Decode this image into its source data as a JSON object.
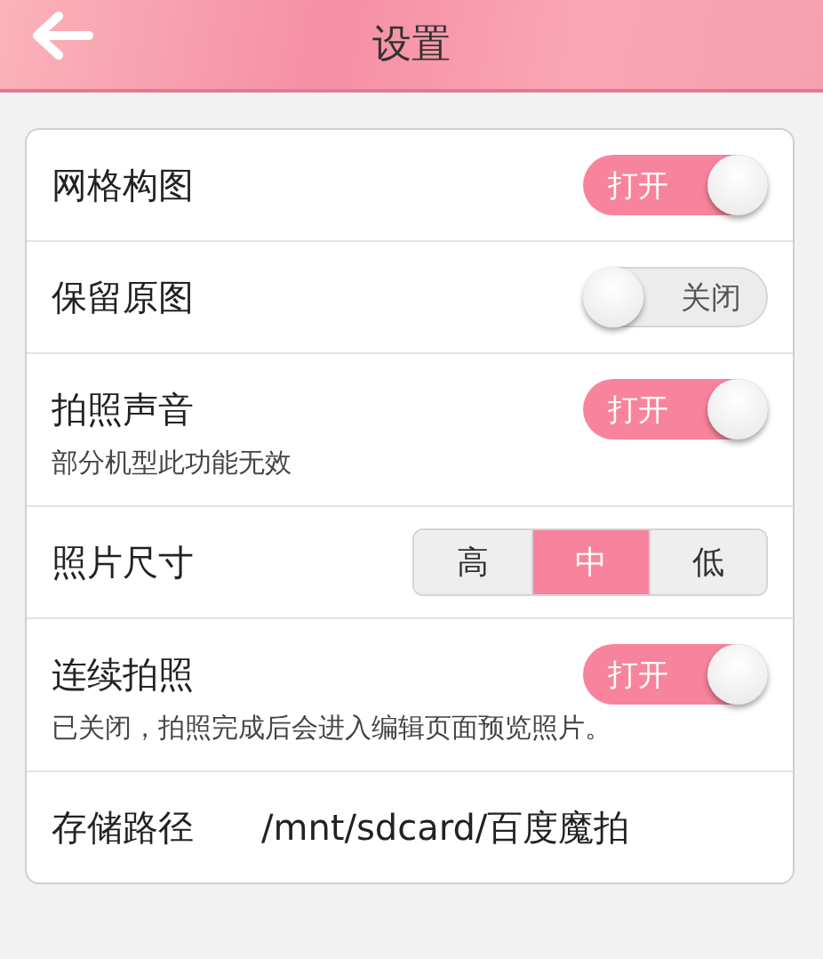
{
  "header": {
    "title": "设置"
  },
  "settings": [
    {
      "kind": "toggle",
      "label": "网格构图",
      "on": true,
      "switch_text": "打开"
    },
    {
      "kind": "toggle",
      "label": "保留原图",
      "on": false,
      "switch_text": "关闭"
    },
    {
      "kind": "toggle",
      "label": "拍照声音",
      "on": true,
      "switch_text": "打开",
      "note": "部分机型此功能无效"
    },
    {
      "kind": "segmented",
      "label": "照片尺寸",
      "options": [
        {
          "label": "高",
          "selected": false
        },
        {
          "label": "中",
          "selected": true
        },
        {
          "label": "低",
          "selected": false
        }
      ]
    },
    {
      "kind": "toggle",
      "label": "连续拍照",
      "on": true,
      "switch_text": "打开",
      "note": "已关闭，拍照完成后会进入编辑页面预览照片。"
    },
    {
      "kind": "path",
      "label": "存储路径",
      "value": "/mnt/sdcard/百度魔拍"
    }
  ]
}
